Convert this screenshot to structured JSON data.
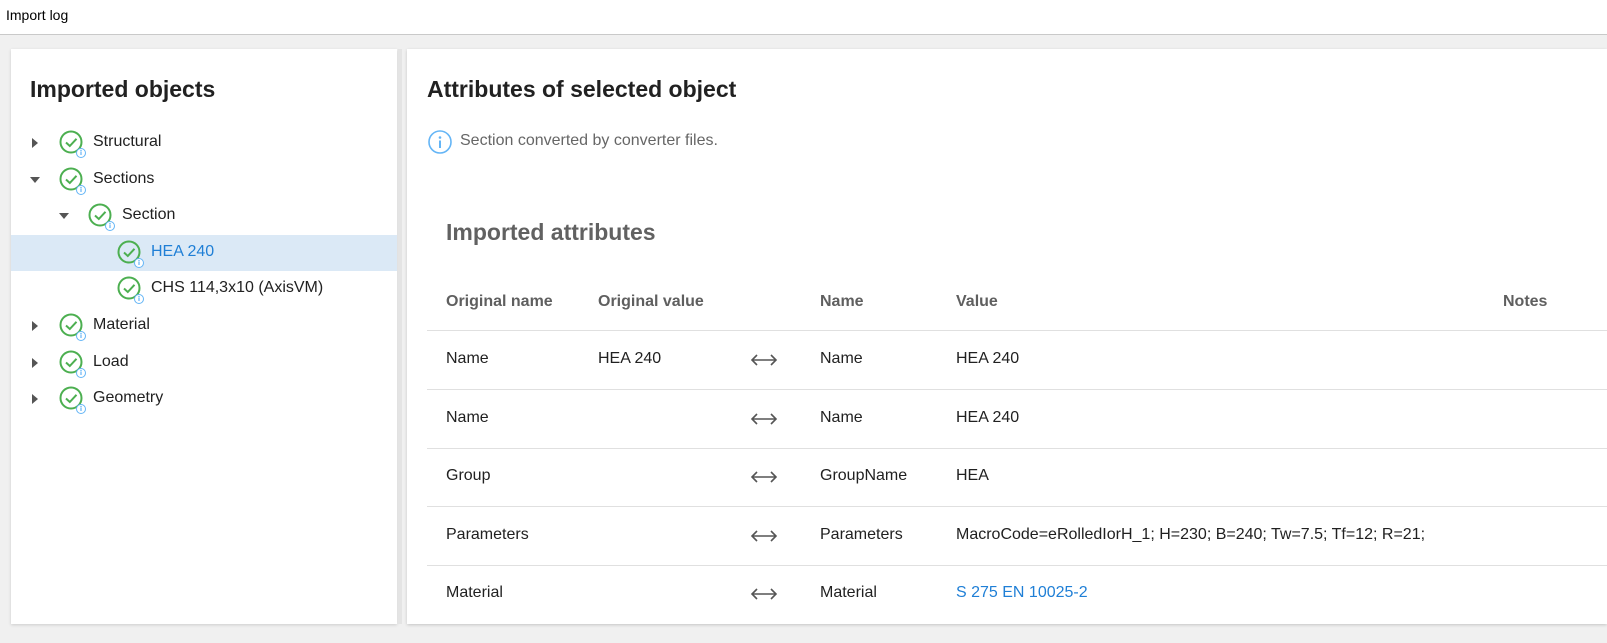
{
  "window": {
    "title": "Import log"
  },
  "left": {
    "title": "Imported objects",
    "tree": [
      {
        "label": "Structural",
        "level": 0,
        "caret": "collapsed",
        "selected": false
      },
      {
        "label": "Sections",
        "level": 0,
        "caret": "expanded",
        "selected": false
      },
      {
        "label": "Section",
        "level": 1,
        "caret": "expanded",
        "selected": false
      },
      {
        "label": "HEA 240",
        "level": 2,
        "caret": "none",
        "selected": true
      },
      {
        "label": "CHS 114,3x10 (AxisVM)",
        "level": 2,
        "caret": "none",
        "selected": false
      },
      {
        "label": "Material",
        "level": 0,
        "caret": "collapsed",
        "selected": false
      },
      {
        "label": "Load",
        "level": 0,
        "caret": "collapsed",
        "selected": false
      },
      {
        "label": "Geometry",
        "level": 0,
        "caret": "collapsed",
        "selected": false
      }
    ]
  },
  "right": {
    "title": "Attributes of selected object",
    "info": "Section converted by converter files.",
    "imported_title": "Imported attributes",
    "columns": {
      "original_name": "Original name",
      "original_value": "Original value",
      "name": "Name",
      "value": "Value",
      "notes": "Notes"
    },
    "rows": [
      {
        "original_name": "Name",
        "original_value": "HEA 240",
        "name": "Name",
        "value": "HEA 240",
        "notes": "",
        "link": false
      },
      {
        "original_name": "Name",
        "original_value": "",
        "name": "Name",
        "value": "HEA 240",
        "notes": "",
        "link": false
      },
      {
        "original_name": "Group",
        "original_value": "",
        "name": "GroupName",
        "value": "HEA",
        "notes": "",
        "link": false
      },
      {
        "original_name": "Parameters",
        "original_value": "",
        "name": "Parameters",
        "value": "MacroCode=eRolledIorH_1; H=230; B=240; Tw=7.5; Tf=12; R=21;",
        "notes": "",
        "link": false
      },
      {
        "original_name": "Material",
        "original_value": "",
        "name": "Material",
        "value": "S 275 EN 10025-2",
        "notes": "",
        "link": true
      }
    ]
  },
  "icons": {
    "status": "success-check-icon",
    "info_badge": "info-badge-icon",
    "mapping": "double-arrow-icon"
  },
  "colors": {
    "success": "#4caf50",
    "info": "#64b5f6",
    "accent": "#1f7fd6",
    "selection": "#dbe9f6"
  }
}
